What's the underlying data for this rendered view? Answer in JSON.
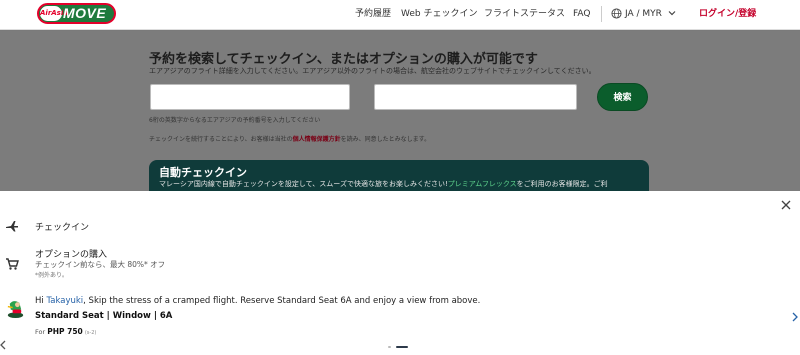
{
  "header": {
    "logo_air": "AirAsia",
    "logo_move": "MOVE",
    "nav": [
      "予約履歴",
      "Web チェックイン",
      "フライトステータス",
      "FAQ"
    ],
    "locale": "JA / MYR",
    "login": "ログイン/登録"
  },
  "main": {
    "headline": "予約を検索してチェックイン、またはオプションの購入が可能です",
    "subline": "エアアジアのフライト詳細を入力してください。エアアジア以外のフライトの場合は、航空会社のウェブサイトでチェックインしてください。",
    "booking_input_value": "",
    "lastname_input_value": "",
    "search_button": "検索",
    "hint": "6桁の英数字からなるエアアジアの予約番号を入力してください",
    "consent_prefix": "チェックインを続行することにより、お客様は当社の",
    "consent_link": "個人情報保護方針",
    "consent_suffix": "を読み、同意したとみなします。"
  },
  "auto_checkin": {
    "title": "自動チェックイン",
    "desc_prefix": "マレーシア国内線で自動チェックインを設定して、スムーズで快適な旅をお楽しみください!",
    "desc_link": "プレミアムフレックス",
    "desc_suffix": "をご利用のお客様限定。ご利"
  },
  "sheet": {
    "checkin_label": "チェックイン",
    "addons_title": "オプションの購入",
    "addons_sub": "チェックイン前なら、最大 80%* オフ",
    "addons_note": "*例外あり。",
    "greet_prefix": "Hi ",
    "greet_name": "Takayuki",
    "greet_suffix": ", Skip the stress of a cramped flight. Reserve Standard Seat 6A and enjoy a view from above.",
    "seat_name": "Standard Seat | Window | 6A",
    "price_prefix": "For ",
    "price_amount": "PHP 750",
    "price_tag": "(s-2)"
  },
  "colors": {
    "brand_red": "#e4002b",
    "brand_green": "#0b5d2c",
    "card_dark": "#0f3b3a",
    "link_blue": "#2763a8"
  },
  "icons": [
    "globe-icon",
    "chevron-down-icon",
    "close-icon",
    "airplane-icon",
    "cart-icon",
    "arrow-left-icon",
    "arrow-right-icon"
  ]
}
